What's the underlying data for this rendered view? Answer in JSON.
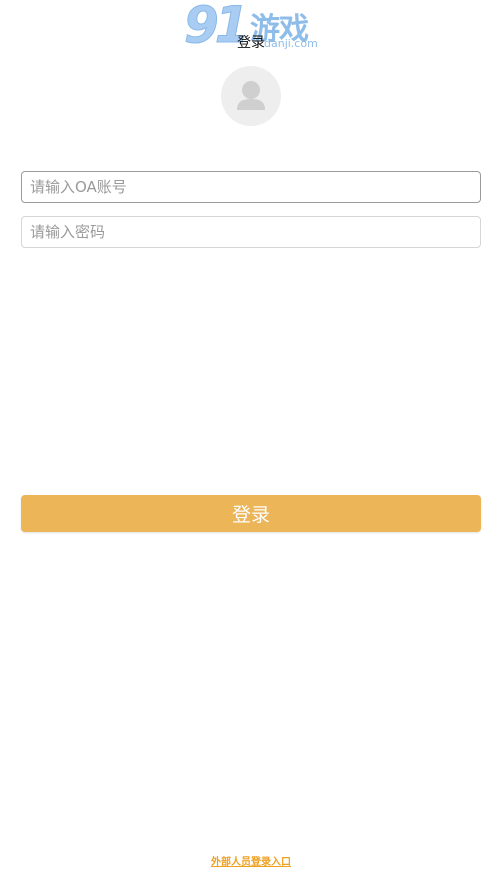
{
  "watermark": {
    "number": "91",
    "chinese": "游戏",
    "domain": "danji.com"
  },
  "header": {
    "title": "登录"
  },
  "avatar": {
    "icon": "user-silhouette-icon"
  },
  "form": {
    "account_placeholder": "请输入OA账号",
    "account_value": "",
    "password_placeholder": "请输入密码",
    "password_value": "",
    "submit_label": "登录"
  },
  "footer": {
    "external_login_label": "外部人员登录入口"
  },
  "colors": {
    "accent": "#ebb558",
    "link": "#f0a020",
    "avatar_bg": "#eeeeee"
  }
}
